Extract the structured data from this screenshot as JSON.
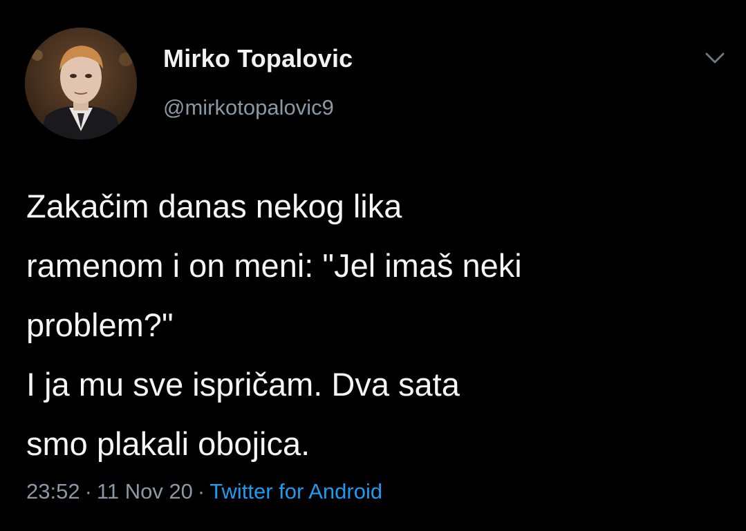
{
  "author": {
    "display_name": "Mirko Topalovic",
    "handle": "@mirkotopalovic9"
  },
  "tweet": {
    "lines": [
      "Zakačim danas nekog lika",
      "ramenom i on meni: \"Jel imaš neki",
      "problem?\"",
      "I ja mu sve ispričam. Dva sata",
      "smo plakali obojica."
    ]
  },
  "meta": {
    "time": "23:52",
    "separator": "·",
    "date": "11 Nov 20",
    "source": "Twitter for Android"
  },
  "icons": {
    "menu": "chevron-down-icon",
    "avatar": "profile-photo"
  },
  "colors": {
    "background": "#000000",
    "text": "#f5f5f5",
    "secondary": "#8b98a5",
    "link": "#1d9bf0"
  }
}
